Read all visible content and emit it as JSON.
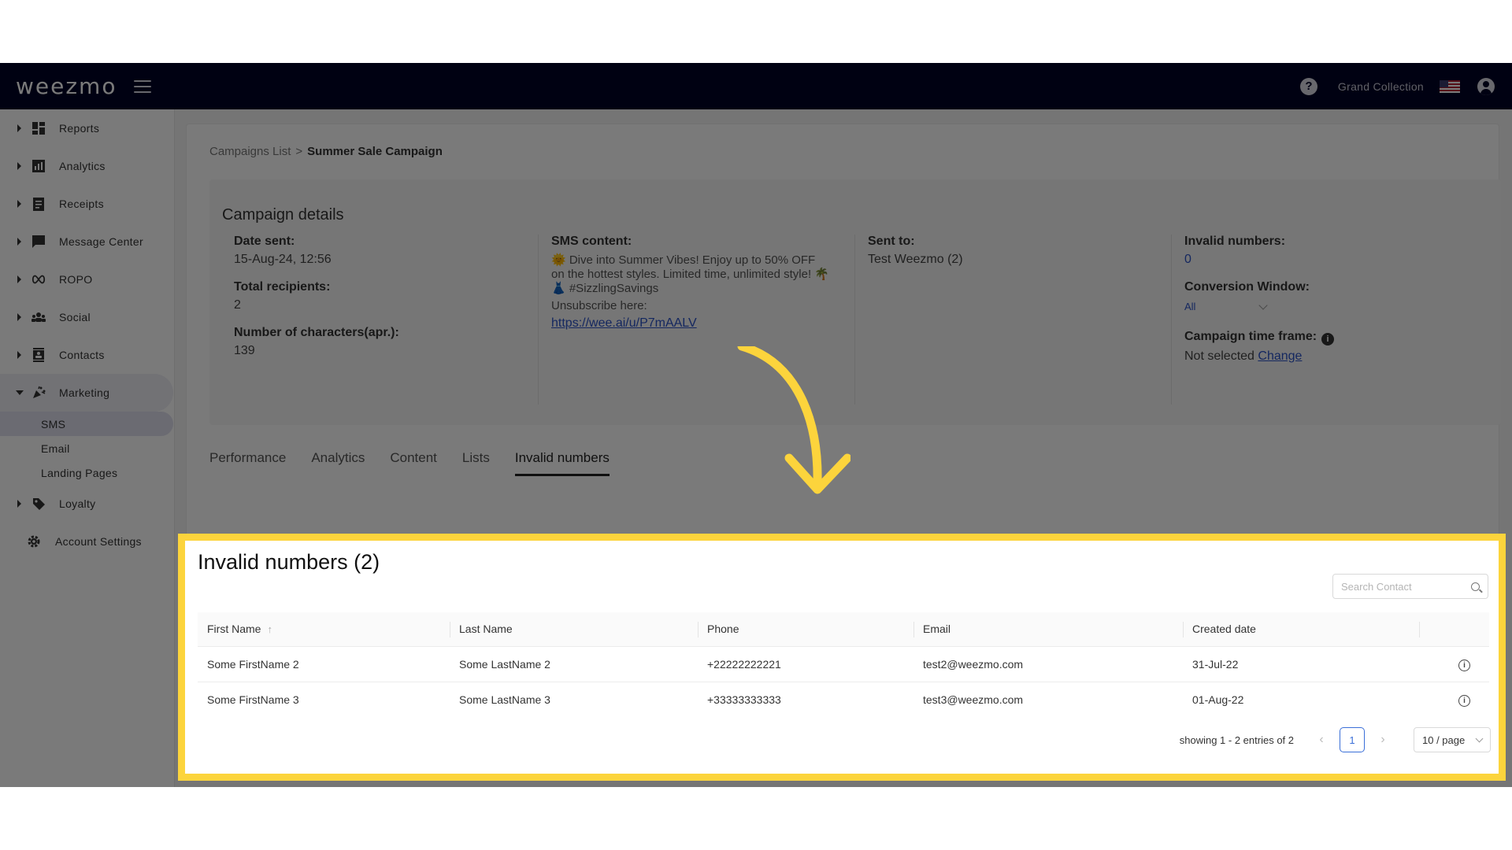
{
  "topbar": {
    "logo": "weezmo",
    "account_name": "Grand Collection"
  },
  "sidebar": {
    "items": [
      {
        "label": "Reports",
        "icon": "dashboard-icon"
      },
      {
        "label": "Analytics",
        "icon": "analytics-icon"
      },
      {
        "label": "Receipts",
        "icon": "receipt-icon"
      },
      {
        "label": "Message Center",
        "icon": "message-icon"
      },
      {
        "label": "ROPO",
        "icon": "infinity-icon"
      },
      {
        "label": "Social",
        "icon": "people-icon"
      },
      {
        "label": "Contacts",
        "icon": "contacts-icon"
      },
      {
        "label": "Marketing",
        "icon": "megaphone-icon"
      }
    ],
    "marketing_sub": [
      {
        "label": "SMS"
      },
      {
        "label": "Email"
      },
      {
        "label": "Landing Pages"
      }
    ],
    "loyalty": {
      "label": "Loyalty",
      "icon": "tag-icon"
    },
    "settings": {
      "label": "Account Settings",
      "icon": "gear-icon"
    }
  },
  "breadcrumb": {
    "parent": "Campaigns List",
    "separator": ">",
    "current": "Summer Sale Campaign"
  },
  "details": {
    "title": "Campaign details",
    "date_sent_label": "Date sent:",
    "date_sent": "15-Aug-24, 12:56",
    "total_recipients_label": "Total recipients:",
    "total_recipients": "2",
    "chars_label": "Number of characters(apr.):",
    "chars": "139",
    "sms_content_label": "SMS content:",
    "sms_content": "🌞 Dive into Summer Vibes! Enjoy up to 50% OFF on the hottest styles. Limited time, unlimited style! 🌴👗 #SizzlingSavings",
    "unsubscribe": "Unsubscribe here:",
    "sms_link": "https://wee.ai/u/P7mAALV",
    "sent_to_label": "Sent to:",
    "sent_to": "Test Weezmo (2)",
    "invalid_label": "Invalid numbers:",
    "invalid_count": "0",
    "conversion_label": "Conversion Window:",
    "conversion_value": "All",
    "timeframe_label": "Campaign time frame:",
    "timeframe_value": "Not selected",
    "change_link": "Change"
  },
  "tabs": [
    "Performance",
    "Analytics",
    "Content",
    "Lists",
    "Invalid numbers"
  ],
  "invalid": {
    "title": "Invalid numbers (2)",
    "search_placeholder": "Search Contact",
    "columns": [
      "First Name",
      "Last Name",
      "Phone",
      "Email",
      "Created date"
    ],
    "rows": [
      {
        "first": "Some FirstName 2",
        "last": "Some LastName 2",
        "phone": "+22222222221",
        "email": "test2@weezmo.com",
        "created": "31-Jul-22"
      },
      {
        "first": "Some FirstName 3",
        "last": "Some LastName 3",
        "phone": "+33333333333",
        "email": "test3@weezmo.com",
        "created": "01-Aug-22"
      }
    ],
    "pagination": {
      "summary": "showing 1 - 2 entries of 2",
      "page": "1",
      "page_size": "10 / page"
    }
  },
  "colors": {
    "topbar": "#020327",
    "highlight": "#fcd43c",
    "link": "#2b52c7"
  }
}
